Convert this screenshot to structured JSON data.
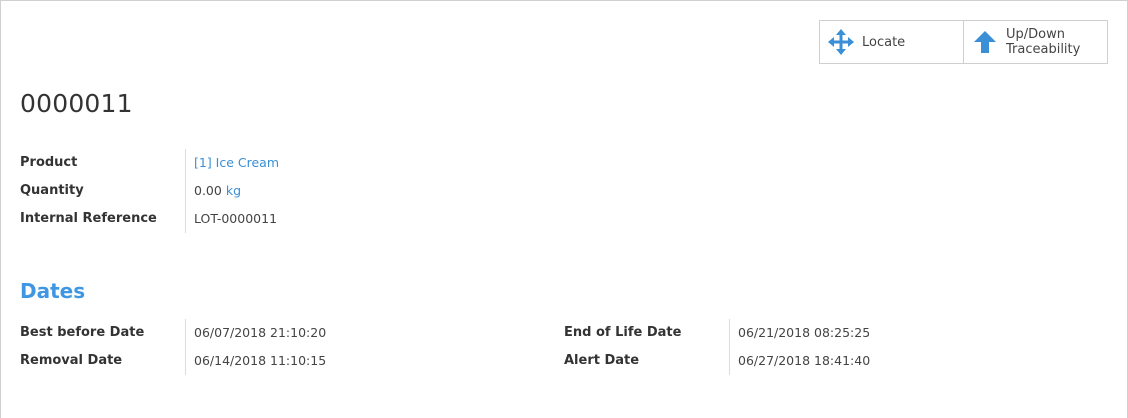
{
  "buttons": {
    "locate": {
      "label": "Locate",
      "icon": "move-arrows-icon"
    },
    "traceability": {
      "label_line1": "Up/Down",
      "label_line2": "Traceability",
      "icon": "arrow-up-icon"
    }
  },
  "record": {
    "title": "0000011",
    "fields": {
      "product_label": "Product",
      "product_value": "[1] Ice Cream",
      "quantity_label": "Quantity",
      "quantity_value": "0.00",
      "quantity_unit": "kg",
      "internal_ref_label": "Internal Reference",
      "internal_ref_value": "LOT-0000011"
    }
  },
  "dates": {
    "section_title": "Dates",
    "best_before_label": "Best before Date",
    "best_before_value": "06/07/2018 21:10:20",
    "removal_label": "Removal Date",
    "removal_value": "06/14/2018 11:10:15",
    "end_of_life_label": "End of Life Date",
    "end_of_life_value": "06/21/2018 08:25:25",
    "alert_label": "Alert Date",
    "alert_value": "06/27/2018 18:41:40"
  },
  "colors": {
    "accent": "#3f97e3",
    "link": "#3a8fd6",
    "text": "#333333",
    "border": "#cfcfcf"
  }
}
